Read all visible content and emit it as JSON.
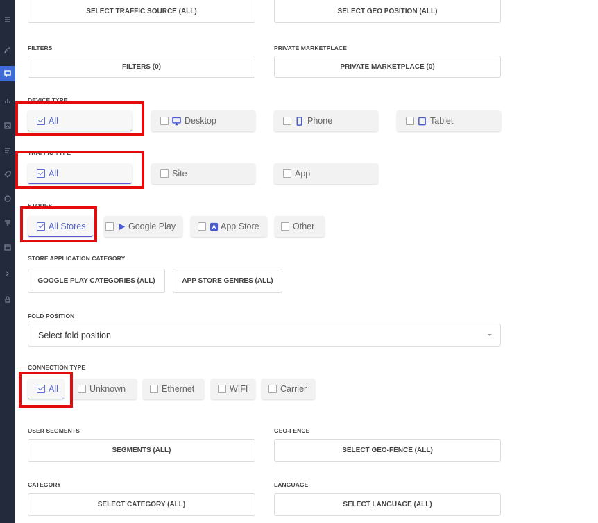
{
  "buttons": {
    "traffic_source": "SELECT TRAFFIC SOURCE (ALL)",
    "geo_position": "SELECT GEO POSITION (ALL)",
    "filters": "FILTERS (0)",
    "private_marketplace": "PRIVATE MARKETPLACE (0)",
    "google_play_categories": "GOOGLE PLAY CATEGORIES (ALL)",
    "app_store_genres": "APP STORE GENRES (ALL)",
    "segments": "SEGMENTS (ALL)",
    "geo_fence": "SELECT GEO-FENCE (ALL)",
    "category": "SELECT CATEGORY (ALL)",
    "language": "SELECT LANGUAGE (ALL)"
  },
  "labels": {
    "filters": "FILTERS",
    "private_marketplace": "PRIVATE MARKETPLACE",
    "device_type": "DEVICE TYPE",
    "traffic_type": "TRAFFIC TYPE",
    "stores": "STORES",
    "store_app_category": "STORE APPLICATION CATEGORY",
    "fold_position": "FOLD POSITION",
    "connection_type": "CONNECTION TYPE",
    "user_segments": "USER SEGMENTS",
    "geo_fence": "GEO-FENCE",
    "category": "CATEGORY",
    "language": "LANGUAGE"
  },
  "device_type": {
    "all": {
      "label": "All",
      "checked": true
    },
    "desktop": {
      "label": "Desktop",
      "icon": "desktop-icon"
    },
    "phone": {
      "label": "Phone",
      "icon": "phone-icon"
    },
    "tablet": {
      "label": "Tablet",
      "icon": "tablet-icon"
    }
  },
  "traffic_type": {
    "all": {
      "label": "All",
      "checked": true
    },
    "site": {
      "label": "Site"
    },
    "app": {
      "label": "App"
    }
  },
  "stores": {
    "all": {
      "label": "All Stores",
      "checked": true
    },
    "google_play": {
      "label": "Google Play",
      "icon": "google-play-icon"
    },
    "app_store": {
      "label": "App Store",
      "icon": "app-store-icon"
    },
    "other": {
      "label": "Other"
    }
  },
  "fold_position": {
    "placeholder": "Select fold position"
  },
  "connection_type": {
    "all": {
      "label": "All",
      "checked": true
    },
    "unknown": {
      "label": "Unknown"
    },
    "ethernet": {
      "label": "Ethernet"
    },
    "wifi": {
      "label": "WIFI"
    },
    "carrier": {
      "label": "Carrier"
    }
  },
  "colors": {
    "accent": "#5a5ad6",
    "highlight": "#e30b0b",
    "sidebar": "#232a3b",
    "sidebar_active": "#3f6ad8"
  }
}
